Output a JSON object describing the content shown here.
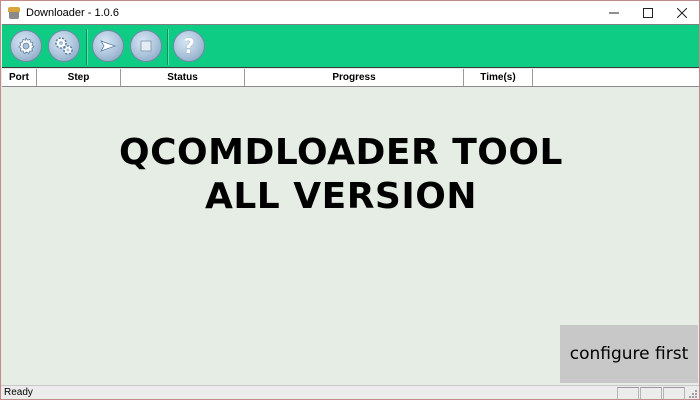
{
  "window": {
    "title": "Downloader - 1.0.6",
    "controls": {
      "minimize": "—",
      "maximize": "□",
      "close": "✕"
    }
  },
  "toolbar": {
    "buttons": [
      {
        "icon": "gear-icon"
      },
      {
        "icon": "gears-icon"
      },
      {
        "icon": "play-icon"
      },
      {
        "icon": "stop-icon"
      },
      {
        "icon": "help-icon",
        "glyph": "?"
      }
    ],
    "color": "#0fcc84"
  },
  "columns": [
    "Port",
    "Step",
    "Status",
    "Progress",
    "Time(s)"
  ],
  "banner": {
    "line1": "QCOMDLOADER TOOL",
    "line2": "ALL VERSION"
  },
  "configure_button": "configure first",
  "statusbar": {
    "text": "Ready"
  }
}
